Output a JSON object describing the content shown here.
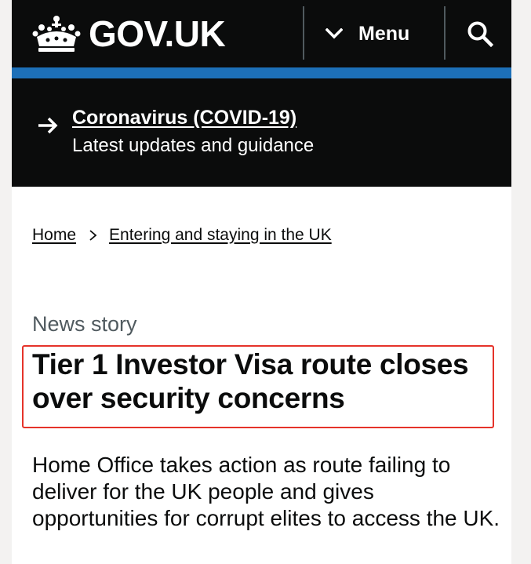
{
  "header": {
    "logo_text": "GOV.UK",
    "menu_label": "Menu",
    "search_icon": "search-icon",
    "crown_icon": "crown-icon",
    "menu_icon": "chevron-down-icon"
  },
  "colors": {
    "header_bg": "#0b0c0c",
    "accent_bar": "#1d70b8",
    "highlight_box": "#e5332a",
    "caption": "#505a5f"
  },
  "banner": {
    "link_text": "Coronavirus (COVID-19)",
    "subtext": "Latest updates and guidance",
    "icon": "arrow-right-icon"
  },
  "breadcrumb": {
    "items": [
      {
        "label": "Home"
      },
      {
        "label": "Entering and staying in the UK"
      }
    ],
    "separator_icon": "chevron-right-icon"
  },
  "article": {
    "caption": "News story",
    "title": "Tier 1 Investor Visa route closes over security concerns",
    "lead": "Home Office takes action as route failing to deliver for the UK people and gives opportunities for corrupt elites to access the UK."
  }
}
